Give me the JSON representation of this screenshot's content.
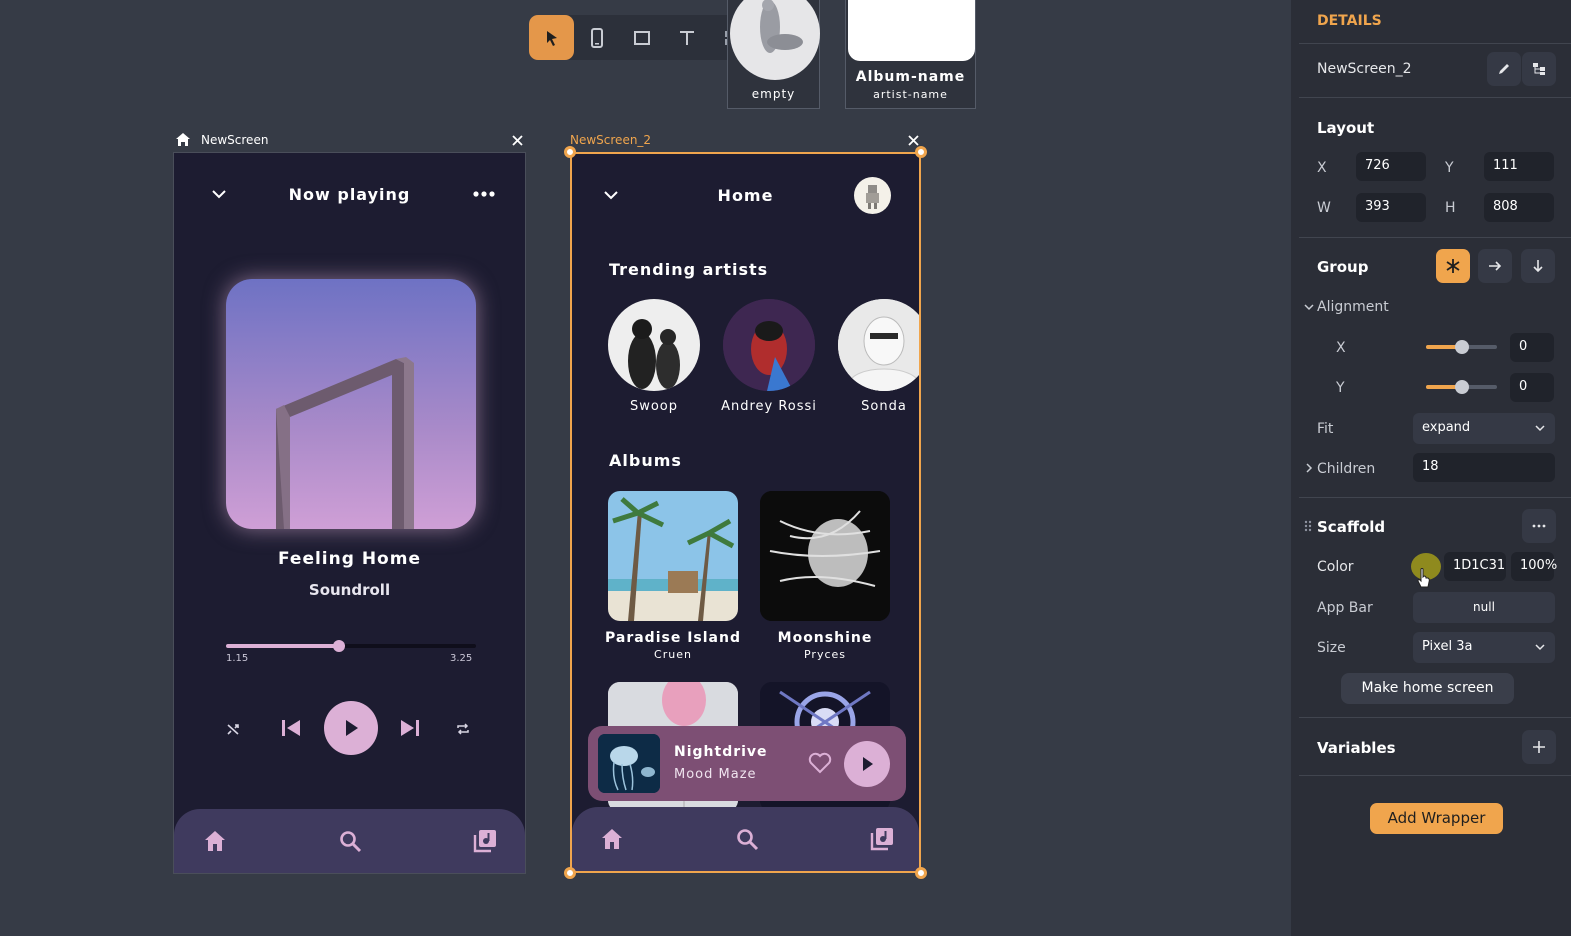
{
  "toolbar": {
    "tools": [
      "pointer-tool",
      "phone-frame-tool",
      "rectangle-tool",
      "text-tool",
      "components-tool"
    ]
  },
  "components": [
    {
      "label": "empty"
    },
    {
      "title": "Album-name",
      "subtitle": "artist-name"
    }
  ],
  "screen1": {
    "name": "NewScreen",
    "title": "Now playing",
    "song": "Feeling Home",
    "artist": "Soundroll",
    "elapsed": "1.15",
    "duration": "3.25",
    "progress": 0.45
  },
  "screen2": {
    "name": "NewScreen_2",
    "title": "Home",
    "trending_heading": "Trending artists",
    "artists": [
      "Swoop",
      "Andrey Rossi",
      "Sonda"
    ],
    "albums_heading": "Albums",
    "albums": [
      {
        "title": "Paradise Island",
        "artist": "Cruen"
      },
      {
        "title": "Moonshine",
        "artist": "Pryces"
      }
    ],
    "mini_player": {
      "title": "Nightdrive",
      "artist": "Mood Maze"
    }
  },
  "details": {
    "heading": "DETAILS",
    "screen_name": "NewScreen_2",
    "layout_heading": "Layout",
    "x_label": "X",
    "x": "726",
    "y_label": "Y",
    "y": "111",
    "w_label": "W",
    "w": "393",
    "h_label": "H",
    "h": "808",
    "group_heading": "Group",
    "alignment_label": "Alignment",
    "align_x_label": "X",
    "align_x": "0",
    "align_y_label": "Y",
    "align_y": "0",
    "fit_label": "Fit",
    "fit": "expand",
    "children_label": "Children",
    "children": "18",
    "scaffold_heading": "Scaffold",
    "color_label": "Color",
    "color_hex": "1D1C31",
    "color_opacity": "100%",
    "swatch_color": "#8f8a1e",
    "appbar_label": "App Bar",
    "appbar": "null",
    "size_label": "Size",
    "size": "Pixel 3a",
    "make_home_label": "Make home screen",
    "variables_heading": "Variables",
    "add_wrapper_label": "Add Wrapper"
  },
  "colors": {
    "accent": "#f0a54d",
    "screen_bg": "#1d1c31",
    "nav_bg": "#3f3a5e",
    "pink": "#dcb0d6",
    "mini_player": "#7d4f74"
  }
}
